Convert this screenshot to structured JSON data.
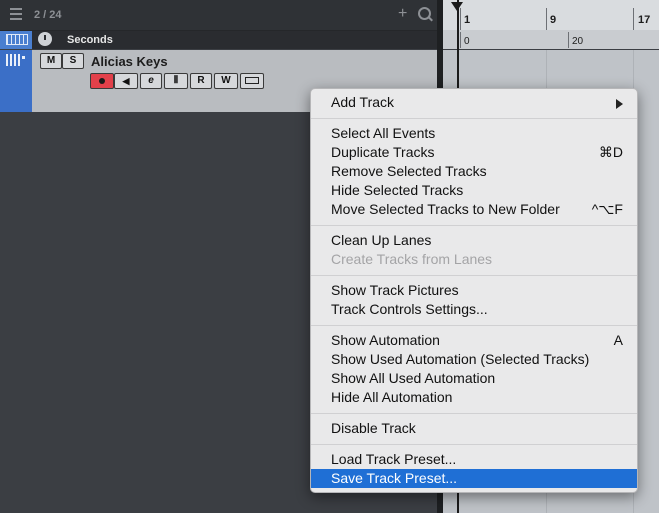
{
  "track_list": {
    "track_count": "2 / 24",
    "ruler_track": {
      "label": "Seconds"
    },
    "instrument_track": {
      "name": "Alicias Keys",
      "mute_label": "M",
      "solo_label": "S",
      "read_label": "R",
      "write_label": "W"
    }
  },
  "ruler": {
    "bars": [
      "1",
      "9",
      "17"
    ],
    "seconds": [
      "0",
      "20"
    ]
  },
  "context_menu": {
    "groups": [
      [
        {
          "label": "Add Track",
          "submenu": true
        }
      ],
      [
        {
          "label": "Select All Events"
        },
        {
          "label": "Duplicate Tracks",
          "shortcut": "⌘D"
        },
        {
          "label": "Remove Selected Tracks"
        },
        {
          "label": "Hide Selected Tracks"
        },
        {
          "label": "Move Selected Tracks to New Folder",
          "shortcut": "^⌥F"
        }
      ],
      [
        {
          "label": "Clean Up Lanes"
        },
        {
          "label": "Create Tracks from Lanes",
          "disabled": true
        }
      ],
      [
        {
          "label": "Show Track Pictures"
        },
        {
          "label": "Track Controls Settings..."
        }
      ],
      [
        {
          "label": "Show Automation",
          "shortcut": "A"
        },
        {
          "label": "Show Used Automation (Selected Tracks)"
        },
        {
          "label": "Show All Used Automation"
        },
        {
          "label": "Hide All Automation"
        }
      ],
      [
        {
          "label": "Disable Track"
        }
      ],
      [
        {
          "label": "Load Track Preset..."
        },
        {
          "label": "Save Track Preset...",
          "highlighted": true
        }
      ]
    ]
  },
  "colors": {
    "accent": "#1f6fd5",
    "track_color": "#3b6fc7",
    "record_button": "#e2404a"
  }
}
